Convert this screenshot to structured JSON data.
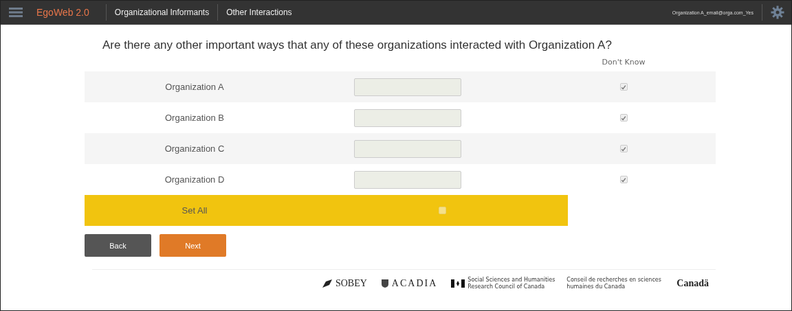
{
  "nav": {
    "brand": "EgoWeb 2.0",
    "links": [
      "Organizational Informants",
      "Other Interactions"
    ],
    "user": "Organization A_email@orga.com_Yes"
  },
  "question": "Are there any other important ways that any of these organizations interacted with Organization A?",
  "column_header": "Don't Know",
  "rows": [
    {
      "label": "Organization A",
      "value": "",
      "dont_know": true,
      "disabled": true
    },
    {
      "label": "Organization B",
      "value": "",
      "dont_know": true,
      "disabled": true
    },
    {
      "label": "Organization C",
      "value": "",
      "dont_know": true,
      "disabled": true
    },
    {
      "label": "Organization D",
      "value": "",
      "dont_know": true,
      "disabled": true
    }
  ],
  "set_all": {
    "label": "Set All",
    "checked": false
  },
  "buttons": [
    {
      "label": "Back",
      "kind": "secondary"
    },
    {
      "label": "Next",
      "kind": "primary"
    }
  ],
  "footer": {
    "logos": [
      {
        "kind": "sobey",
        "text": "SOBEY"
      },
      {
        "kind": "acadia",
        "text": "ACADIA"
      },
      {
        "kind": "sshrc",
        "text": "Social Sciences and Humanities Research Council of Canada",
        "text_fr": "Conseil de recherches en sciences humaines du Canada"
      },
      {
        "kind": "canada",
        "text": "Canadä"
      }
    ]
  }
}
